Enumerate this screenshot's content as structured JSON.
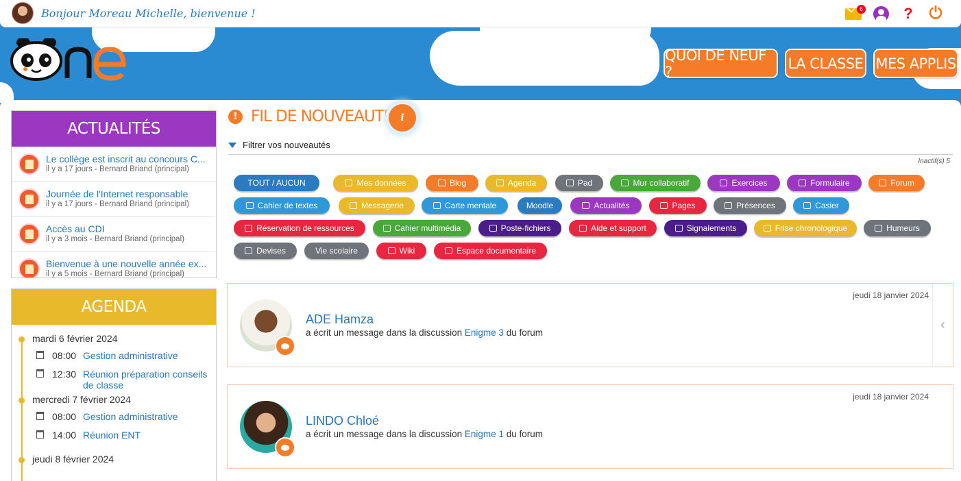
{
  "topbar": {
    "greeting": "Bonjour Moreau Michelle, bienvenue !",
    "mail_count": "6",
    "help_label": "?",
    "power_label": "⏻"
  },
  "nav": {
    "whats_new": "QUOI DE NEUF ?",
    "class": "LA CLASSE",
    "apps": "MES APPLIS"
  },
  "actualites": {
    "title": "ACTUALITÉS",
    "items": [
      {
        "title": "Le collège est inscrit au concours C...",
        "meta": "il y a 17 jours - Bernard Briand (principal)"
      },
      {
        "title": "Journée de l'Internet responsable",
        "meta": "il y a 17 jours - Bernard Briand (principal)"
      },
      {
        "title": "Accès au CDI",
        "meta": "il y a 3 mois - Bernard Briand (principal)"
      },
      {
        "title": "Bienvenue à une nouvelle année ex...",
        "meta": "il y a 5 mois - Bernard Briand (principal)"
      }
    ]
  },
  "agenda": {
    "title": "AGENDA",
    "days": [
      {
        "label": "mardi 6 février 2024",
        "events": [
          {
            "time": "08:00",
            "title": "Gestion administrative"
          },
          {
            "time": "12:30",
            "title": "Réunion préparation conseils de classe"
          }
        ]
      },
      {
        "label": "mercredi 7 février 2024",
        "events": [
          {
            "time": "08:00",
            "title": "Gestion administrative"
          },
          {
            "time": "14:00",
            "title": "Réunion ENT"
          }
        ]
      },
      {
        "label": "jeudi 8 février 2024",
        "events": []
      }
    ]
  },
  "feed": {
    "title": "FIL DE NOUVEAUTÉS",
    "info": "i",
    "filter_label": "Filtrer vos nouveautés",
    "inactive": "Inactif(s) 5",
    "chips": [
      {
        "label": "TOUT  /  AUCUN",
        "color": "#2a7bbf",
        "icon": ""
      },
      {
        "label": "Mes données",
        "color": "#e8b92a",
        "icon": "document-icon"
      },
      {
        "label": "Blog",
        "color": "#f47b28",
        "icon": "megaphone-icon"
      },
      {
        "label": "Agenda",
        "color": "#e8b92a",
        "icon": "calendar-icon"
      },
      {
        "label": "Pad",
        "color": "#6f737a",
        "icon": "pad-icon"
      },
      {
        "label": "Mur collaboratif",
        "color": "#49a83a",
        "icon": "wall-icon"
      },
      {
        "label": "Exercices",
        "color": "#9b37c1",
        "icon": "exercises-icon"
      },
      {
        "label": "Formulaire",
        "color": "#9b37c1",
        "icon": "form-icon"
      },
      {
        "label": "Forum",
        "color": "#f47b28",
        "icon": "forum-icon"
      },
      {
        "label": "Cahier de textes",
        "color": "#2e98d9",
        "icon": "notebook-icon"
      },
      {
        "label": "Messagerie",
        "color": "#e8b92a",
        "icon": "mail-icon"
      },
      {
        "label": "Carte mentale",
        "color": "#2e98d9",
        "icon": "mindmap-icon"
      },
      {
        "label": "Moodle",
        "color": "#2a7bbf",
        "icon": ""
      },
      {
        "label": "Actualités",
        "color": "#9b37c1",
        "icon": "news-icon"
      },
      {
        "label": "Pages",
        "color": "#e8263f",
        "icon": "pages-icon"
      },
      {
        "label": "Présences",
        "color": "#6f737a",
        "icon": "attendance-icon"
      },
      {
        "label": "Casier",
        "color": "#2e98d9",
        "icon": "locker-icon"
      },
      {
        "label": "Réservation de ressources",
        "color": "#e8263f",
        "icon": "booking-icon"
      },
      {
        "label": "Cahier multimédia",
        "color": "#49a83a",
        "icon": "multimedia-icon"
      },
      {
        "label": "Poste-fichiers",
        "color": "#4a1d8a",
        "icon": "files-icon"
      },
      {
        "label": "Aide et support",
        "color": "#e8263f",
        "icon": "support-icon"
      },
      {
        "label": "Signalements",
        "color": "#4a1d8a",
        "icon": "gear-icon"
      },
      {
        "label": "Frise chronologique",
        "color": "#e8b92a",
        "icon": "timeline-icon"
      },
      {
        "label": "Humeurs",
        "color": "#6f737a",
        "icon": "mood-icon"
      },
      {
        "label": "Devises",
        "color": "#6f737a",
        "icon": "motto-icon"
      },
      {
        "label": "Vie scolaire",
        "color": "#6f737a",
        "icon": ""
      },
      {
        "label": "Wiki",
        "color": "#e8263f",
        "icon": "wiki-icon"
      },
      {
        "label": "Espace documentaire",
        "color": "#e8263f",
        "icon": "docs-icon"
      }
    ],
    "cards": [
      {
        "date": "jeudi 18 janvier 2024",
        "name": "ADE Hamza",
        "prefix": "a écrit un message dans la discussion",
        "link": "Enigme 3",
        "suffix": "du forum"
      },
      {
        "date": "jeudi 18 janvier 2024",
        "name": "LINDO Chloé",
        "prefix": "a écrit un message dans la discussion",
        "link": "Enigme 1",
        "suffix": "du forum"
      }
    ]
  }
}
